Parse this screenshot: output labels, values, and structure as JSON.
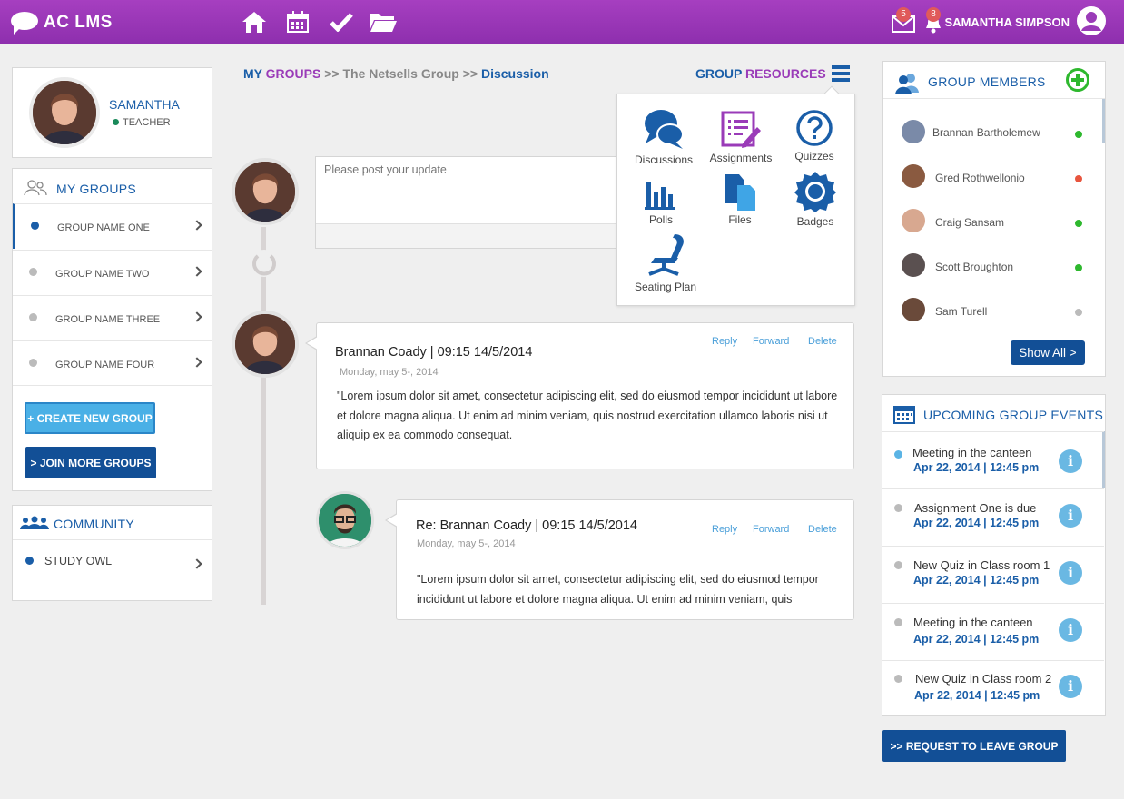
{
  "app": {
    "logo": "AC  LMS",
    "user_name": "SAMANTHA SIMPSON",
    "mail_count": "5",
    "notif_count": "8"
  },
  "profile": {
    "name": "SAMANTHA",
    "role": "TEACHER"
  },
  "my_groups": {
    "title": "MY GROUPS",
    "items": [
      {
        "label": "GROUP NAME ONE",
        "color": "#1a5ea8"
      },
      {
        "label": "GROUP NAME TWO",
        "color": "#bbbbbb"
      },
      {
        "label": "GROUP NAME THREE",
        "color": "#bbbbbb"
      },
      {
        "label": "GROUP NAME FOUR",
        "color": "#bbbbbb"
      }
    ],
    "create_btn": "+ CREATE NEW GROUP",
    "join_btn": "> JOIN MORE GROUPS"
  },
  "community": {
    "title": "COMMUNITY",
    "items": [
      {
        "label": "STUDY OWL"
      }
    ]
  },
  "breadcrumb": {
    "my": "MY",
    "groups": "GROUPS",
    "sep1": ">>",
    "group": "The Netsells Group",
    "sep2": ">>",
    "current": "Discussion"
  },
  "resources": {
    "title1": "GROUP",
    "title2": "RESOURCES",
    "items": [
      "Discussions",
      "Assignments",
      "Quizzes",
      "Polls",
      "Files",
      "Badges",
      "Seating Plan"
    ]
  },
  "composer": {
    "placeholder": "Please post your update"
  },
  "posts": [
    {
      "header": "Brannan Coady |  09:15 14/5/2014",
      "date": "Monday, may 5-, 2014",
      "body": "\"Lorem ipsum dolor sit amet, consectetur adipiscing elit, sed do eiusmod tempor incididunt ut labore et dolore magna aliqua. Ut enim ad minim veniam, quis nostrud exercitation ullamco laboris nisi ut aliquip ex ea commodo consequat.",
      "reply": "Reply",
      "forward": "Forward",
      "delete": "Delete"
    },
    {
      "header": "Re: Brannan Coady |  09:15 14/5/2014",
      "date": "Monday, may 5-, 2014",
      "body": "\"Lorem ipsum dolor sit amet, consectetur adipiscing elit, sed do eiusmod tempor incididunt ut labore et dolore magna aliqua. Ut enim ad minim veniam, quis",
      "reply": "Reply",
      "forward": "Forward",
      "delete": "Delete"
    }
  ],
  "members": {
    "title": "GROUP MEMBERS",
    "show_all": "Show All >",
    "items": [
      {
        "name": "Brannan Bartholemew",
        "status": "#2eb82e"
      },
      {
        "name": "Gred Rothwellonio",
        "status": "#e8553e"
      },
      {
        "name": "Craig Sansam",
        "status": "#2eb82e"
      },
      {
        "name": "Scott Broughton",
        "status": "#2eb82e"
      },
      {
        "name": "Sam Turell",
        "status": "#bbbbbb"
      }
    ]
  },
  "events": {
    "title": "UPCOMING GROUP EVENTS",
    "items": [
      {
        "title": "Meeting in the canteen",
        "date": "Apr 22, 2014 | 12:45 pm",
        "color": "#5bb4e5"
      },
      {
        "title": "Assignment One is due",
        "date": "Apr 22, 2014 | 12:45 pm",
        "color": "#bbbbbb"
      },
      {
        "title": "New Quiz in Class room 1",
        "date": "Apr 22, 2014 | 12:45 pm",
        "color": "#bbbbbb"
      },
      {
        "title": "Meeting in the canteen",
        "date": "Apr 22, 2014 | 12:45 pm",
        "color": "#bbbbbb"
      },
      {
        "title": "New Quiz in Class room 2",
        "date": "Apr 22, 2014 | 12:45 pm",
        "color": "#bbbbbb"
      }
    ],
    "leave_btn": ">>  REQUEST TO LEAVE GROUP"
  }
}
